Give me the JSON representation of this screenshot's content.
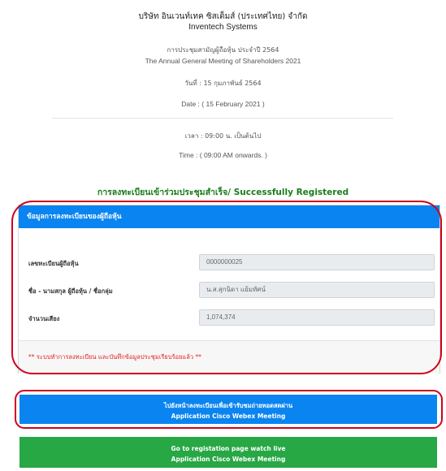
{
  "company": {
    "name_th": "บริษัท อินเวนท์เทค ซิสเต็มส์ (ประเทศไทย) จำกัด",
    "name_en": "Inventech Systems"
  },
  "meeting": {
    "title_th": "การประชุมสามัญผู้ถือหุ้น ประจำปี 2564",
    "title_en": "The Annual General Meeting of Shareholders 2021",
    "date_th": "วันที่ : 15 กุมภาพันธ์ 2564",
    "date_en": "Date : ( 15 February 2021 )",
    "time_th": "เวลา : 09:00 น. เป็นต้นไป",
    "time_en": "Time : ( 09:00 AM onwards. )"
  },
  "status": {
    "success_message": "การลงทะเบียนเข้าร่วมประชุมสำเร็จ/ Successfully Registered"
  },
  "registration_card": {
    "header": "ข้อมูลการลงทะเบียนของผู้ถือหุ้น",
    "rows": [
      {
        "label": "เลขทะเบียนผู้ถือหุ้น",
        "value": "0000000025"
      },
      {
        "label": "ชื่อ - นามสกุล ผู้ถือหุ้น / ชื่อกลุ่ม",
        "value": "น.ส.สุกนิดา แย้มทัศน์"
      },
      {
        "label": "จำนวนเสียง",
        "value": "1,074,374"
      }
    ],
    "notice": "** ระบบทำการลงทะเบียน และบันทึกข้อมูลประชุมเรียบร้อยแล้ว **"
  },
  "buttons": {
    "webex_th_line1": "ไปยังหน้าลงทะเบียนเพื่อเข้ารับชมถ่ายทอดสดผ่าน",
    "webex_th_line2": "Application Cisco Webex Meeting",
    "webex_en_line1": "Go to registation page watch live",
    "webex_en_line2": "Application Cisco Webex Meeting"
  },
  "colors": {
    "primary_blue": "#0a84f0",
    "success_green": "#28a745",
    "success_text": "#1a7d1a",
    "highlight_red": "#d0011b",
    "notice_red": "#e02020"
  }
}
